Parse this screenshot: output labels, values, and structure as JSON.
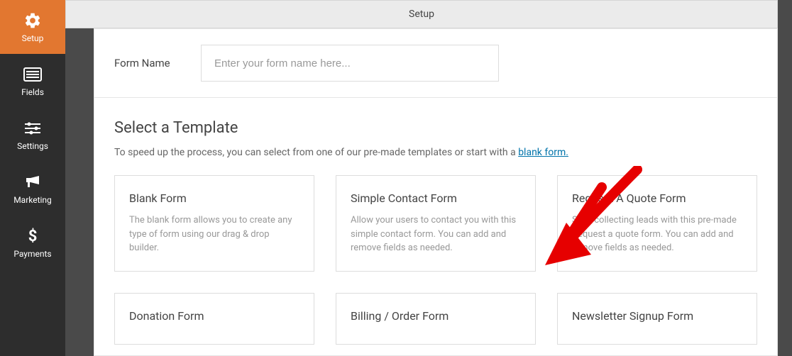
{
  "sidebar": {
    "items": [
      {
        "label": "Setup"
      },
      {
        "label": "Fields"
      },
      {
        "label": "Settings"
      },
      {
        "label": "Marketing"
      },
      {
        "label": "Payments"
      }
    ]
  },
  "topbar": {
    "title": "Setup"
  },
  "form_name": {
    "label": "Form Name",
    "placeholder": "Enter your form name here..."
  },
  "template_section": {
    "title": "Select a Template",
    "desc_prefix": "To speed up the process, you can select from one of our pre-made templates or start with a ",
    "link_text": "blank form."
  },
  "templates": [
    {
      "title": "Blank Form",
      "desc": "The blank form allows you to create any type of form using our drag & drop builder."
    },
    {
      "title": "Simple Contact Form",
      "desc": "Allow your users to contact you with this simple contact form. You can add and remove fields as needed."
    },
    {
      "title": "Request A Quote Form",
      "desc": "Start collecting leads with this pre-made Request a quote form. You can add and remove fields as needed."
    },
    {
      "title": "Donation Form",
      "desc": ""
    },
    {
      "title": "Billing / Order Form",
      "desc": ""
    },
    {
      "title": "Newsletter Signup Form",
      "desc": ""
    }
  ]
}
